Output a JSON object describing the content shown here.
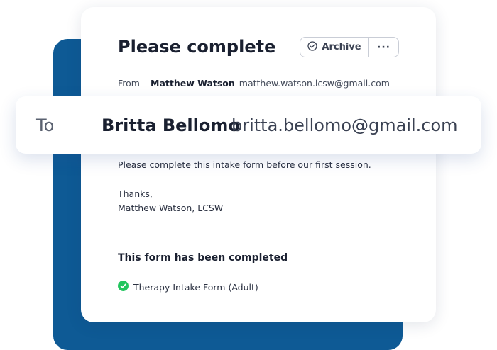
{
  "colors": {
    "backdrop": "#0e5a95",
    "success": "#22c55e"
  },
  "email": {
    "title": "Please complete",
    "actions": {
      "archive_label": "Archive",
      "archive_icon": "check-circle-icon",
      "more_label": "···"
    },
    "from": {
      "label": "From",
      "name": "Matthew Watson",
      "email": "matthew.watson.lcsw@gmail.com"
    },
    "to": {
      "label": "To",
      "name": "Britta Bellomo",
      "email": "britta.bellomo@gmail.com"
    },
    "body": "Please complete this intake form before our first session.",
    "signoff": {
      "line1": "Thanks,",
      "line2": "Matthew Watson, LCSW"
    }
  },
  "completed_section": {
    "heading": "This form has been completed",
    "forms": [
      {
        "name": "Therapy Intake Form (Adult)",
        "status_icon": "check-circle-filled-icon"
      }
    ]
  }
}
